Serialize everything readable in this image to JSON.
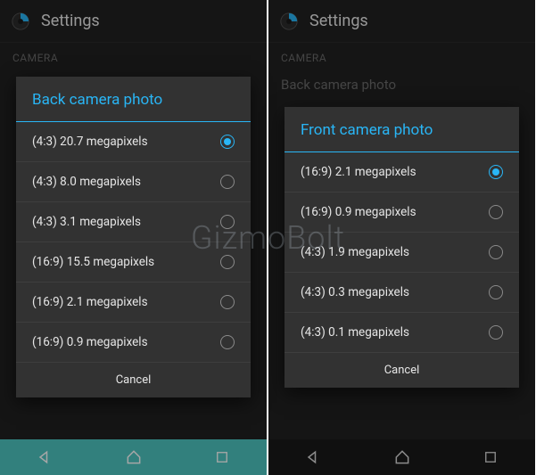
{
  "watermark": "GizmoBolt",
  "left": {
    "header_title": "Settings",
    "section_label": "CAMERA",
    "dialog": {
      "title": "Back camera photo",
      "selected_index": 0,
      "items": [
        {
          "label": "(4:3) 20.7 megapixels"
        },
        {
          "label": "(4:3) 8.0 megapixels"
        },
        {
          "label": "(4:3) 3.1 megapixels"
        },
        {
          "label": "(16:9) 15.5 megapixels"
        },
        {
          "label": "(16:9) 2.1 megapixels"
        },
        {
          "label": "(16:9) 0.9 megapixels"
        }
      ],
      "cancel": "Cancel"
    }
  },
  "right": {
    "header_title": "Settings",
    "section_label": "CAMERA",
    "bg_subtitle": "Back camera photo",
    "dialog": {
      "title": "Front camera photo",
      "selected_index": 0,
      "items": [
        {
          "label": "(16:9) 2.1 megapixels"
        },
        {
          "label": "(16:9) 0.9 megapixels"
        },
        {
          "label": "(4:3) 1.9 megapixels"
        },
        {
          "label": "(4:3) 0.3 megapixels"
        },
        {
          "label": "(4:3) 0.1 megapixels"
        }
      ],
      "cancel": "Cancel"
    }
  }
}
